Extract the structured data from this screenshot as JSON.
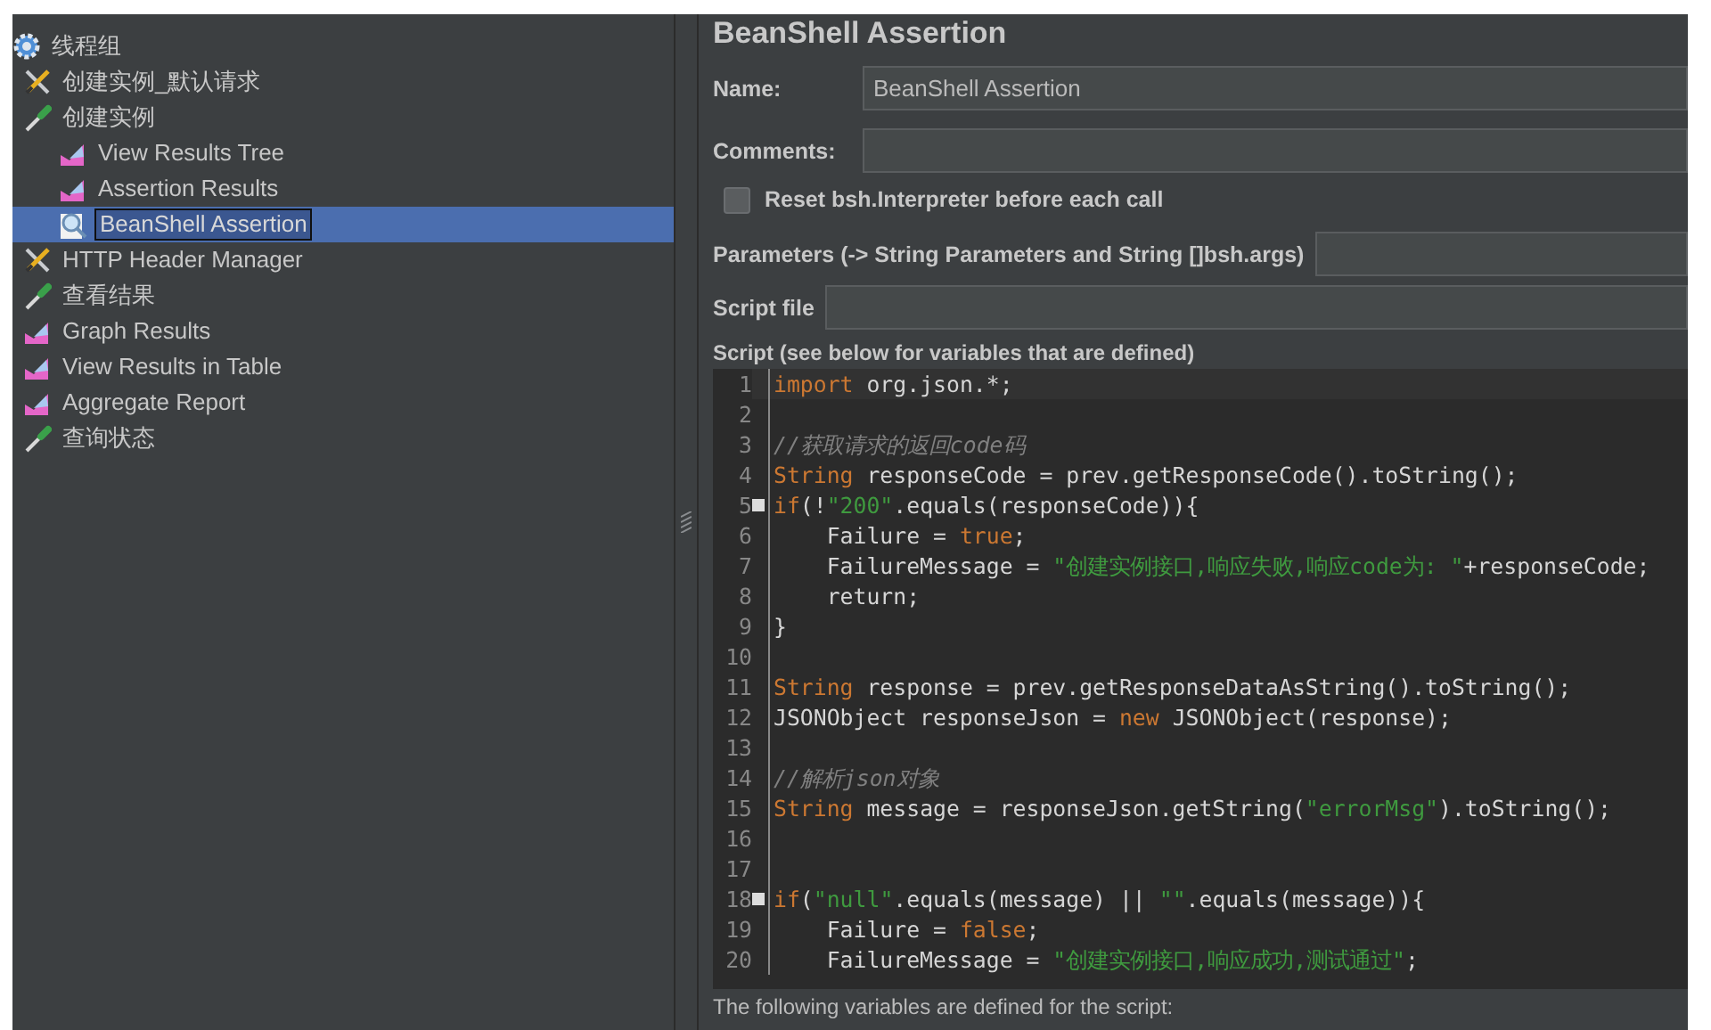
{
  "tree": [
    {
      "label": "线程组",
      "kind": "gear",
      "selected": false,
      "children": [
        {
          "label": "创建实例_默认请求",
          "kind": "tools",
          "selected": false
        },
        {
          "label": "创建实例",
          "kind": "dropper",
          "selected": false,
          "children": [
            {
              "label": "View Results Tree",
              "kind": "chart",
              "selected": false
            },
            {
              "label": "Assertion Results",
              "kind": "chart",
              "selected": false
            },
            {
              "label": "BeanShell Assertion",
              "kind": "magnifier",
              "selected": true
            }
          ]
        },
        {
          "label": "HTTP Header Manager",
          "kind": "tools",
          "selected": false
        },
        {
          "label": "查看结果",
          "kind": "dropper",
          "selected": false
        },
        {
          "label": "Graph Results",
          "kind": "chart",
          "selected": false
        },
        {
          "label": "View Results in Table",
          "kind": "chart",
          "selected": false
        },
        {
          "label": "Aggregate Report",
          "kind": "chart",
          "selected": false
        },
        {
          "label": "查询状态",
          "kind": "dropper",
          "selected": false
        }
      ]
    }
  ],
  "panel": {
    "title": "BeanShell Assertion",
    "name": {
      "label": "Name:",
      "value": "BeanShell Assertion"
    },
    "comments": {
      "label": "Comments:"
    },
    "reset": {
      "label": "Reset bsh.Interpreter before each call",
      "checked": false
    },
    "parameters": {
      "label": "Parameters (-> String Parameters and String []bsh.args)"
    },
    "script_file": {
      "label": "Script file"
    },
    "script_label": "Script (see below for variables that are defined)",
    "script": [
      {
        "number": "1",
        "fold": false,
        "tokens": [
          {
            "kind": "kw",
            "text": "import"
          },
          {
            "kind": "plain",
            "text": " org.json.*;"
          }
        ]
      },
      {
        "number": "2",
        "fold": false
      },
      {
        "number": "3",
        "fold": false,
        "tokens": [
          {
            "kind": "cmt",
            "text": "//获取请求的返回code码"
          }
        ]
      },
      {
        "number": "4",
        "fold": false,
        "tokens": [
          {
            "kind": "kw",
            "text": "String"
          },
          {
            "kind": "plain",
            "text": " responseCode = prev.getResponseCode().toString();"
          }
        ]
      },
      {
        "number": "5",
        "fold": true,
        "tokens": [
          {
            "kind": "kw",
            "text": "if"
          },
          {
            "kind": "plain",
            "text": "(!"
          },
          {
            "kind": "str",
            "text": "\"200\""
          },
          {
            "kind": "plain",
            "text": ".equals(responseCode)){"
          }
        ]
      },
      {
        "number": "6",
        "fold": false,
        "tokens": [
          {
            "kind": "plain",
            "text": "    Failure = "
          },
          {
            "kind": "kw",
            "text": "true"
          },
          {
            "kind": "plain",
            "text": ";"
          }
        ]
      },
      {
        "number": "7",
        "fold": false,
        "tokens": [
          {
            "kind": "plain",
            "text": "    FailureMessage = "
          },
          {
            "kind": "str",
            "text": "\"创建实例接口,响应失败,响应code为: \""
          },
          {
            "kind": "plain",
            "text": "+responseCode;"
          }
        ]
      },
      {
        "number": "8",
        "fold": false,
        "tokens": [
          {
            "kind": "plain",
            "text": "    return;"
          }
        ]
      },
      {
        "number": "9",
        "fold": false,
        "tokens": [
          {
            "kind": "plain",
            "text": "}"
          }
        ]
      },
      {
        "number": "10",
        "fold": false
      },
      {
        "number": "11",
        "fold": false,
        "tokens": [
          {
            "kind": "kw",
            "text": "String"
          },
          {
            "kind": "plain",
            "text": " response = prev.getResponseDataAsString().toString();"
          }
        ]
      },
      {
        "number": "12",
        "fold": false,
        "tokens": [
          {
            "kind": "plain",
            "text": "JSONObject responseJson = "
          },
          {
            "kind": "kw",
            "text": "new"
          },
          {
            "kind": "plain",
            "text": " JSONObject(response);"
          }
        ]
      },
      {
        "number": "13",
        "fold": false
      },
      {
        "number": "14",
        "fold": false,
        "tokens": [
          {
            "kind": "cmt",
            "text": "//解析json对象"
          }
        ]
      },
      {
        "number": "15",
        "fold": false,
        "tokens": [
          {
            "kind": "kw",
            "text": "String"
          },
          {
            "kind": "plain",
            "text": " message = responseJson.getString("
          },
          {
            "kind": "str",
            "text": "\"errorMsg\""
          },
          {
            "kind": "plain",
            "text": ").toString();"
          }
        ]
      },
      {
        "number": "16",
        "fold": false
      },
      {
        "number": "17",
        "fold": false
      },
      {
        "number": "18",
        "fold": true,
        "tokens": [
          {
            "kind": "kw",
            "text": "if"
          },
          {
            "kind": "plain",
            "text": "("
          },
          {
            "kind": "str",
            "text": "\"null\""
          },
          {
            "kind": "plain",
            "text": ".equals(message) || "
          },
          {
            "kind": "str",
            "text": "\"\""
          },
          {
            "kind": "plain",
            "text": ".equals(message)){"
          }
        ]
      },
      {
        "number": "19",
        "fold": false,
        "tokens": [
          {
            "kind": "plain",
            "text": "    Failure = "
          },
          {
            "kind": "kw",
            "text": "false"
          },
          {
            "kind": "plain",
            "text": ";"
          }
        ]
      },
      {
        "number": "20",
        "fold": false,
        "tokens": [
          {
            "kind": "plain",
            "text": "    FailureMessage = "
          },
          {
            "kind": "str",
            "text": "\"创建实例接口,响应成功,测试通过\""
          },
          {
            "kind": "plain",
            "text": ";"
          }
        ]
      }
    ],
    "footer": "The following variables are defined for the script:"
  }
}
